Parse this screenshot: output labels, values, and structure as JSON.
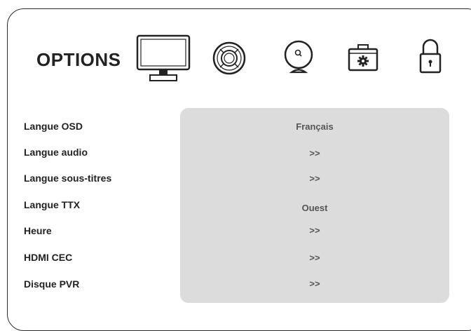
{
  "header": {
    "title": "OPTIONS",
    "tabs": [
      {
        "icon": "tv-icon",
        "selected": true
      },
      {
        "icon": "remote-control-icon"
      },
      {
        "icon": "satellite-dish-icon"
      },
      {
        "icon": "toolbox-gear-icon"
      },
      {
        "icon": "padlock-icon"
      }
    ]
  },
  "settings": [
    {
      "label": "Langue OSD",
      "value": "Français"
    },
    {
      "label": "Langue audio",
      "value": ">>"
    },
    {
      "label": "Langue sous-titres",
      "value": ">>"
    },
    {
      "label": "Langue TTX",
      "value": "Ouest"
    },
    {
      "label": "Heure",
      "value": ">>"
    },
    {
      "label": "HDMI CEC",
      "value": ">>"
    },
    {
      "label": "Disque PVR",
      "value": ">>"
    }
  ],
  "colors": {
    "panel": "#dcdcdc",
    "text": "#222222",
    "value_text": "#555555"
  }
}
